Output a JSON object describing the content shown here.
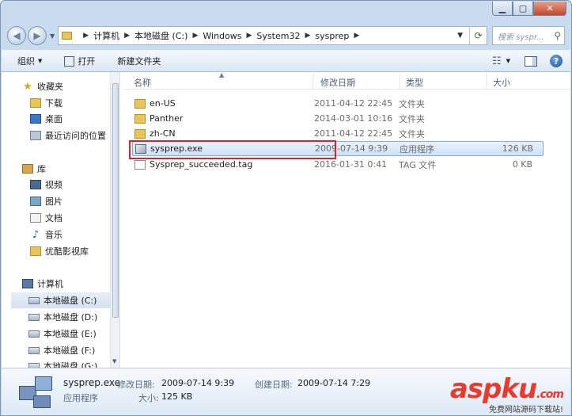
{
  "address": {
    "breadcrumbs": [
      "计算机",
      "本地磁盘 (C:)",
      "Windows",
      "System32",
      "sysprep"
    ],
    "search_placeholder": "搜索 syspr..."
  },
  "toolbar": {
    "organize": "组织",
    "open": "打开",
    "new_folder": "新建文件夹"
  },
  "nav": {
    "favorites_header": "收藏夹",
    "favorites": [
      "下载",
      "桌面",
      "最近访问的位置"
    ],
    "libraries_header": "库",
    "libraries": [
      "视频",
      "图片",
      "文档",
      "音乐",
      "优酷影视库"
    ],
    "computer_header": "计算机",
    "drives": [
      "本地磁盘 (C:)",
      "本地磁盘 (D:)",
      "本地磁盘 (E:)",
      "本地磁盘 (F:)",
      "本地磁盘 (G:)"
    ]
  },
  "columns": {
    "name": "名称",
    "modified": "修改日期",
    "type": "类型",
    "size": "大小"
  },
  "files": [
    {
      "name": "en-US",
      "modified": "2011-04-12 22:45",
      "type": "文件夹",
      "size": "",
      "icon": "folder-icon"
    },
    {
      "name": "Panther",
      "modified": "2014-03-01 10:16",
      "type": "文件夹",
      "size": "",
      "icon": "folder-icon"
    },
    {
      "name": "zh-CN",
      "modified": "2011-04-12 22:45",
      "type": "文件夹",
      "size": "",
      "icon": "folder-icon"
    },
    {
      "name": "sysprep.exe",
      "modified": "2009-07-14 9:39",
      "type": "应用程序",
      "size": "126 KB",
      "icon": "exe-icon"
    },
    {
      "name": "Sysprep_succeeded.tag",
      "modified": "2016-01-31 0:41",
      "type": "TAG 文件",
      "size": "0 KB",
      "icon": "file-icon"
    }
  ],
  "details": {
    "name": "sysprep.exe",
    "modified_label": "修改日期:",
    "modified_value": "2009-07-14 9:39",
    "created_label": "创建日期:",
    "created_value": "2009-07-14 7:29",
    "type": "应用程序",
    "size_label": "大小:",
    "size_value": "125 KB"
  },
  "watermark": {
    "brand": "aspku",
    "suffix": ".com",
    "tagline": "免费网站源码下载站!"
  }
}
